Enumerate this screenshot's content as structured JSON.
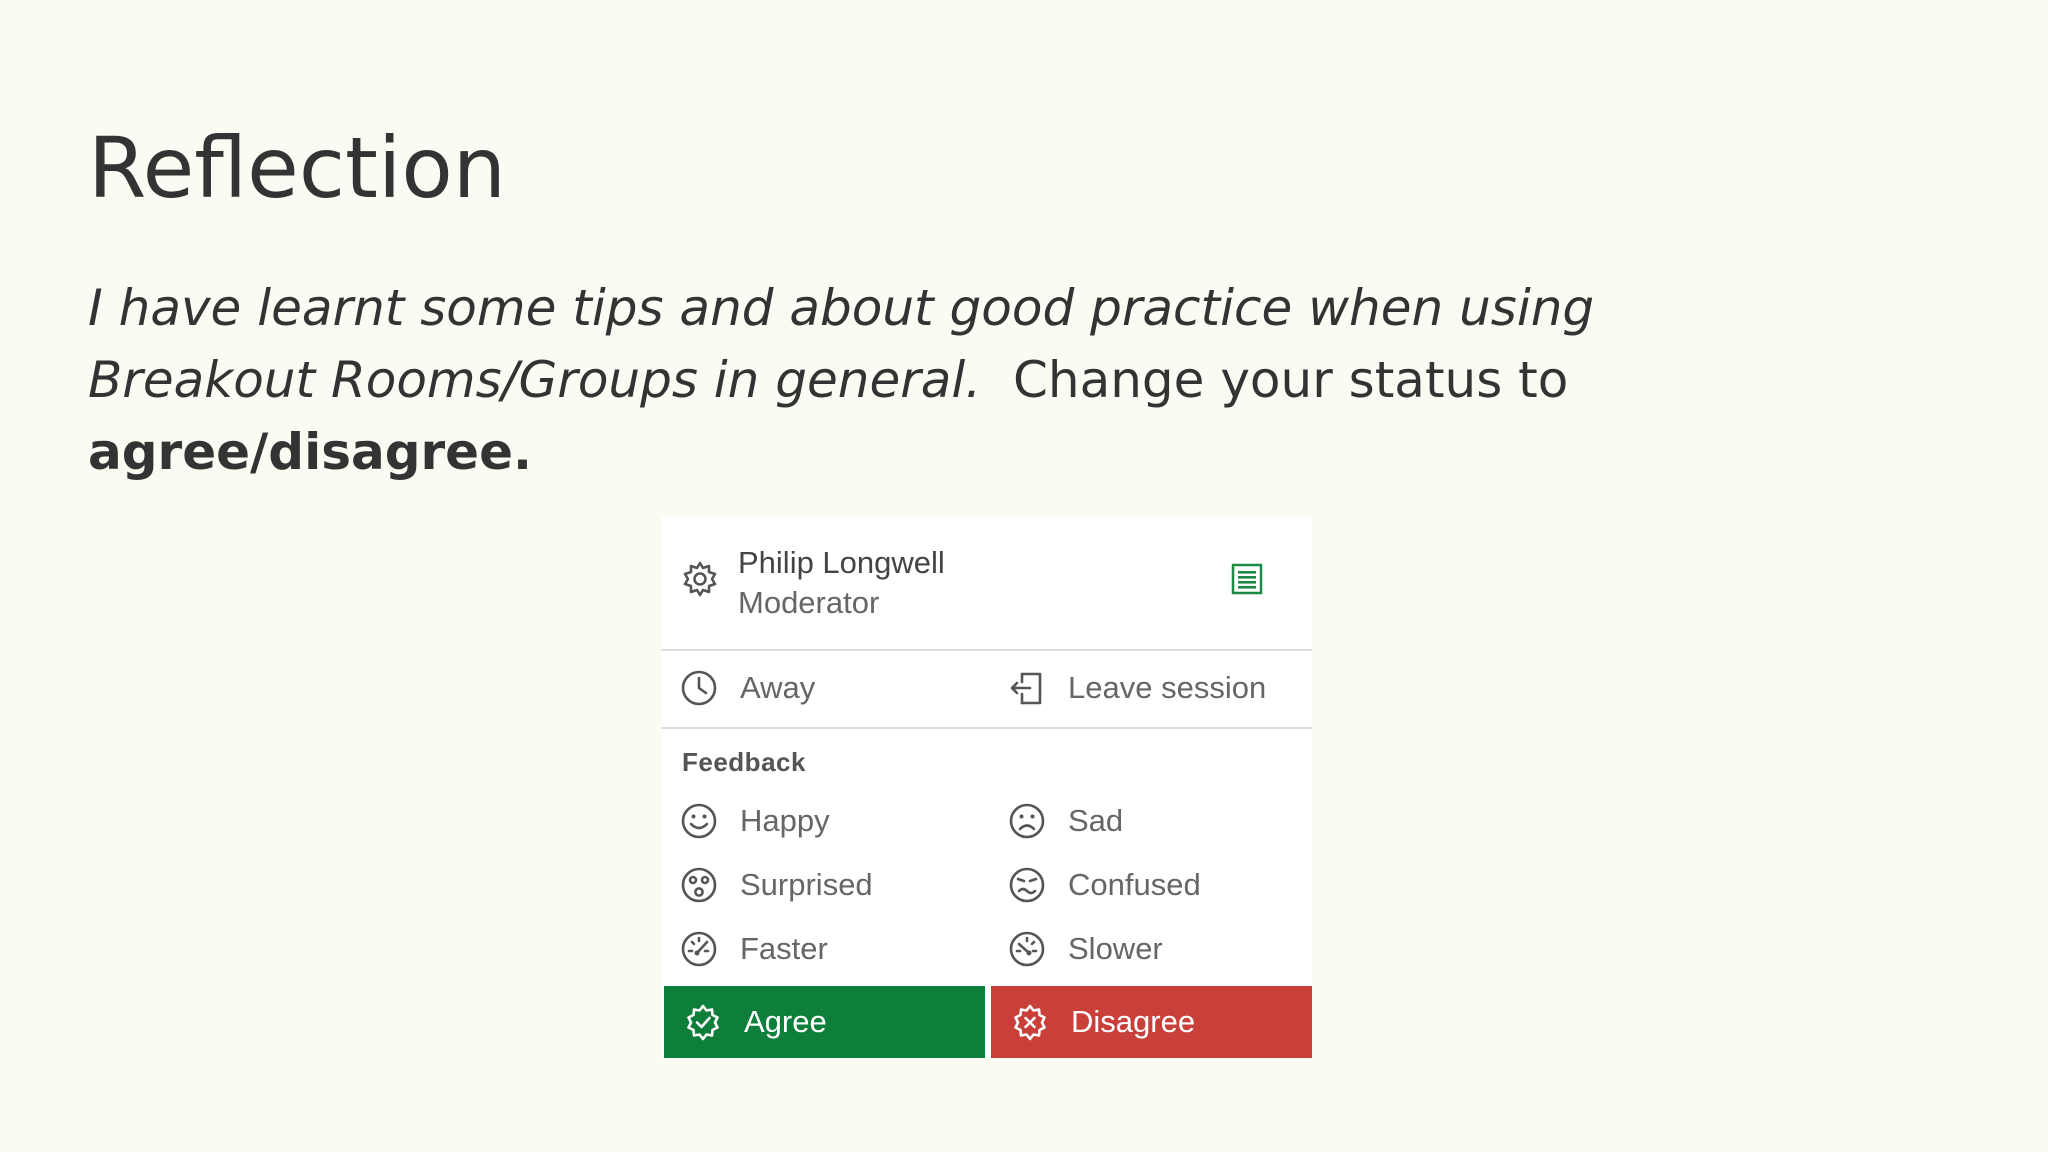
{
  "slide": {
    "title": "Reflection",
    "prompt_italic": "I have learnt some tips and about good practice when using Breakout Rooms/Groups in general.",
    "prompt_plain": "Change your status to",
    "prompt_bold": "agree/disagree."
  },
  "panel": {
    "user_name": "Philip Longwell",
    "user_role": "Moderator",
    "away_label": "Away",
    "leave_label": "Leave session",
    "feedback_heading": "Feedback",
    "feedback": {
      "happy": "Happy",
      "sad": "Sad",
      "surprised": "Surprised",
      "confused": "Confused",
      "faster": "Faster",
      "slower": "Slower"
    },
    "agree_label": "Agree",
    "disagree_label": "Disagree"
  },
  "colors": {
    "background": "#fafbf2",
    "text": "#333333",
    "agree": "#0e7f3b",
    "disagree": "#c9403a",
    "list_icon": "#1b8a45"
  },
  "icons": {
    "header": "gear-icon",
    "menu": "list-icon",
    "away": "clock-icon",
    "leave": "exit-door-icon",
    "happy": "smile-icon",
    "sad": "sad-face-icon",
    "surprised": "surprised-face-icon",
    "confused": "confused-face-icon",
    "faster": "speedometer-fast-icon",
    "slower": "speedometer-slow-icon",
    "agree": "check-badge-icon",
    "disagree": "x-badge-icon"
  }
}
